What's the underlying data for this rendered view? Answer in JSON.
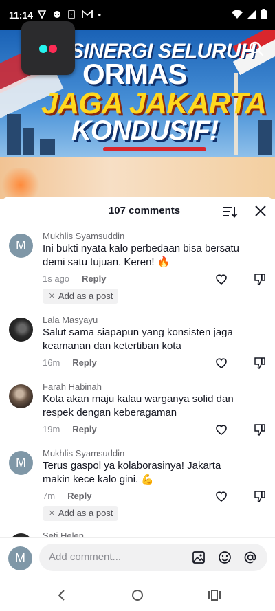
{
  "status_bar": {
    "time": "11:14",
    "notification_icons": [
      "vpn-icon",
      "chat-icon",
      "phone-icon",
      "gmail-icon"
    ],
    "dot": "•"
  },
  "banner": {
    "line1": "SINERGI SELURUH",
    "line2": "ORMAS",
    "line3": "JAGA JAKARTA",
    "line4": "KONDUSIF!"
  },
  "comments_sheet": {
    "title": "107 comments",
    "comments": [
      {
        "username": "Mukhlis Syamsuddin",
        "avatar": "M",
        "text": "Ini bukti nyata kalo perbedaan bisa bersatu demi satu tujuan. Keren! 🔥",
        "time": "1s ago",
        "reply_label": "Reply",
        "chip": "Add as a post"
      },
      {
        "username": "Lala Masyayu",
        "avatar": "",
        "text": "Salut sama siapapun yang konsisten jaga keamanan dan ketertiban kota",
        "time": "16m",
        "reply_label": "Reply"
      },
      {
        "username": "Farah Habinah",
        "avatar": "",
        "text": "Kota akan maju kalau warganya solid dan respek dengan keberagaman",
        "time": "19m",
        "reply_label": "Reply"
      },
      {
        "username": "Mukhlis Syamsuddin",
        "avatar": "M",
        "text": "Terus gaspol ya kolaborasinya! Jakarta makin kece kalo gini. 💪",
        "time": "7m",
        "reply_label": "Reply",
        "chip": "Add as a post"
      },
      {
        "username": "Seti Helen",
        "avatar": ""
      }
    ]
  },
  "composer": {
    "avatar": "M",
    "placeholder": "Add comment..."
  },
  "colors": {
    "accent_avatar": "#7f97a7",
    "text_primary": "#161823",
    "text_secondary": "#8a8b91"
  }
}
